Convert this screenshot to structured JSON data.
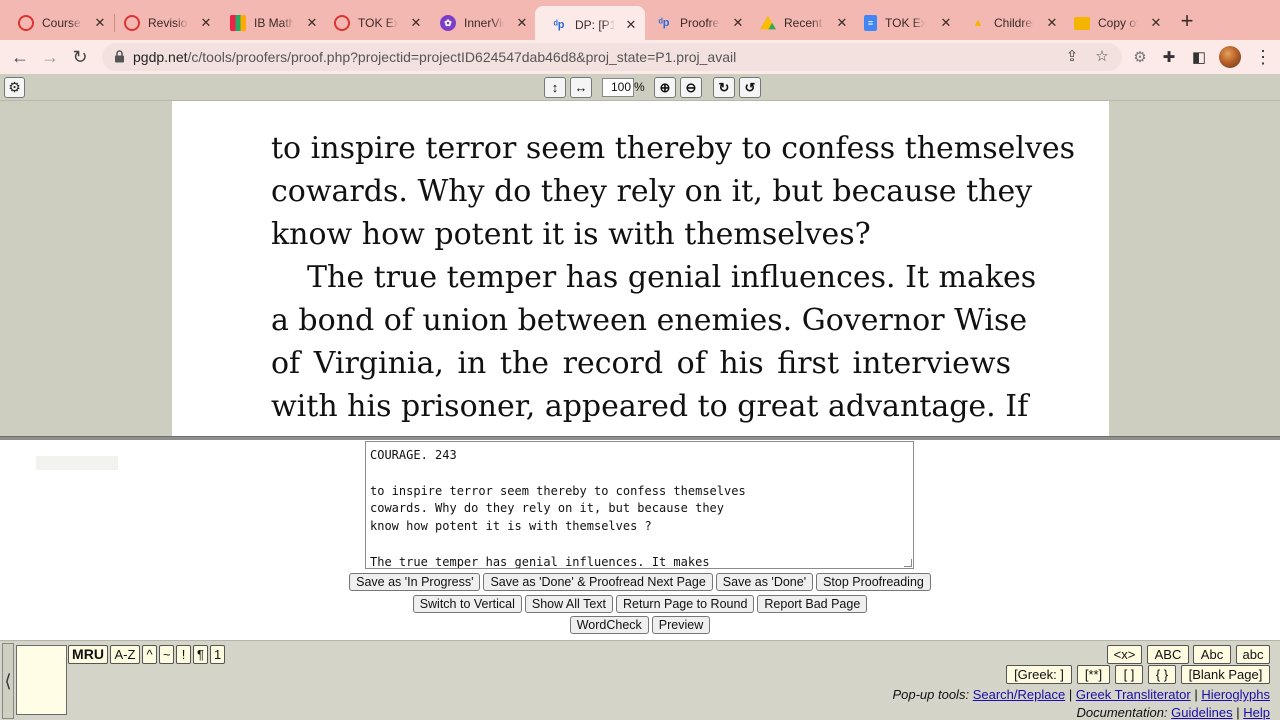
{
  "browser": {
    "tabs": [
      {
        "title": "Course",
        "icon": "course-icon",
        "active": false
      },
      {
        "title": "Revision",
        "icon": "revision-icon",
        "active": false
      },
      {
        "title": "IB Math",
        "icon": "chart-icon",
        "active": false
      },
      {
        "title": "TOK Exh",
        "icon": "tok-icon",
        "active": false
      },
      {
        "title": "InnerVie",
        "icon": "innerview-icon",
        "active": false
      },
      {
        "title": "DP: [P1]",
        "icon": "dp-icon",
        "active": true
      },
      {
        "title": "Proofrea",
        "icon": "dp-icon",
        "active": false
      },
      {
        "title": "Recent",
        "icon": "drive-icon",
        "active": false
      },
      {
        "title": "TOK Exh",
        "icon": "docs-icon",
        "active": false
      },
      {
        "title": "Children",
        "icon": "children-icon",
        "active": false
      },
      {
        "title": "Copy of",
        "icon": "slides-icon",
        "active": false
      }
    ],
    "new_tab": "+",
    "url_domain": "pgdp.net",
    "url_path": "/c/tools/proofers/proof.php?projectid=projectID624547dab46d8&proj_state=P1.proj_avail"
  },
  "proof_toolbar": {
    "zoom_value": "100",
    "zoom_unit": "%"
  },
  "scan_lines": [
    "to inspire terror seem thereby to confess themselves",
    "cowards.  Why do they rely on it, but because they",
    "know how potent it is with themselves?",
    "The true temper has genial influences.  It makes",
    "a bond of union between enemies.  Governor Wise",
    "of Virginia, in the record of his first interviews",
    "with his prisoner, appeared to great advantage.  If"
  ],
  "text_lines": [
    "COURAGE. 243",
    "",
    "to inspire terror seem thereby to confess themselves",
    "cowards. Why do they rely on it, but because they",
    "know how potent it is with themselves ?",
    "",
    "The true temper has genial influences. It makes"
  ],
  "buttons": {
    "row1": [
      "Save as 'In Progress'",
      "Save as 'Done' & Proofread Next Page",
      "Save as 'Done'",
      "Stop Proofreading"
    ],
    "row2": [
      "Switch to Vertical",
      "Show All Text",
      "Return Page to Round",
      "Report Bad Page"
    ],
    "row3": [
      "WordCheck",
      "Preview"
    ]
  },
  "toolbox": {
    "char_tabs": [
      "MRU",
      "A-Z",
      "^",
      "~",
      "!",
      "¶",
      "1"
    ],
    "case_buttons": [
      "<x>",
      "ABC",
      "Abc",
      "abc"
    ],
    "markup_buttons": [
      "[Greek: ]",
      "[**]",
      "[ ]",
      "{ }",
      "[Blank Page]"
    ],
    "popup_label": "Pop-up tools:",
    "popup_links": [
      "Search/Replace",
      "Greek Transliterator",
      "Hieroglyphs"
    ],
    "doc_label": "Documentation:",
    "doc_links": [
      "Guidelines",
      "Help"
    ],
    "separator": "|"
  }
}
